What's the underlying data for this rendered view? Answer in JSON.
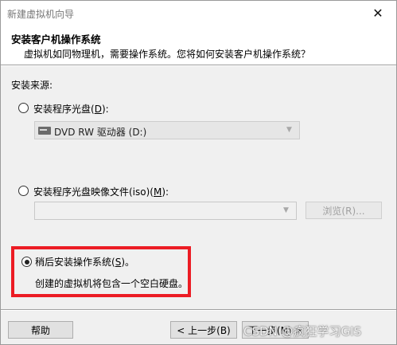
{
  "window": {
    "title": "新建虚拟机向导",
    "close_glyph": "✕"
  },
  "header": {
    "title": "安装客户机操作系统",
    "subtitle": "虚拟机如同物理机，需要操作系统。您将如何安装客户机操作系统？"
  },
  "source": {
    "label": "安装来源:",
    "disc": {
      "label_pre": "安装程序光盘(",
      "key": "D",
      "label_post": "):",
      "selected": false,
      "combo_value": "DVD RW 驱动器 (D:)"
    },
    "iso": {
      "label_pre": "安装程序光盘映像文件(iso)(",
      "key": "M",
      "label_post": "):",
      "selected": false,
      "combo_value": "",
      "browse_label": "浏览(R)..."
    },
    "later": {
      "label_pre": "稍后安装操作系统(",
      "key": "S",
      "label_post": ")。",
      "selected": true,
      "note": "创建的虚拟机将包含一个空白硬盘。"
    }
  },
  "footer": {
    "help": "帮助",
    "back": "< 上一步(B)",
    "next": "下一步(N) >"
  },
  "watermark": "CSDN @疯狂学习GIS",
  "colors": {
    "highlight_box": "#ec1c24"
  }
}
